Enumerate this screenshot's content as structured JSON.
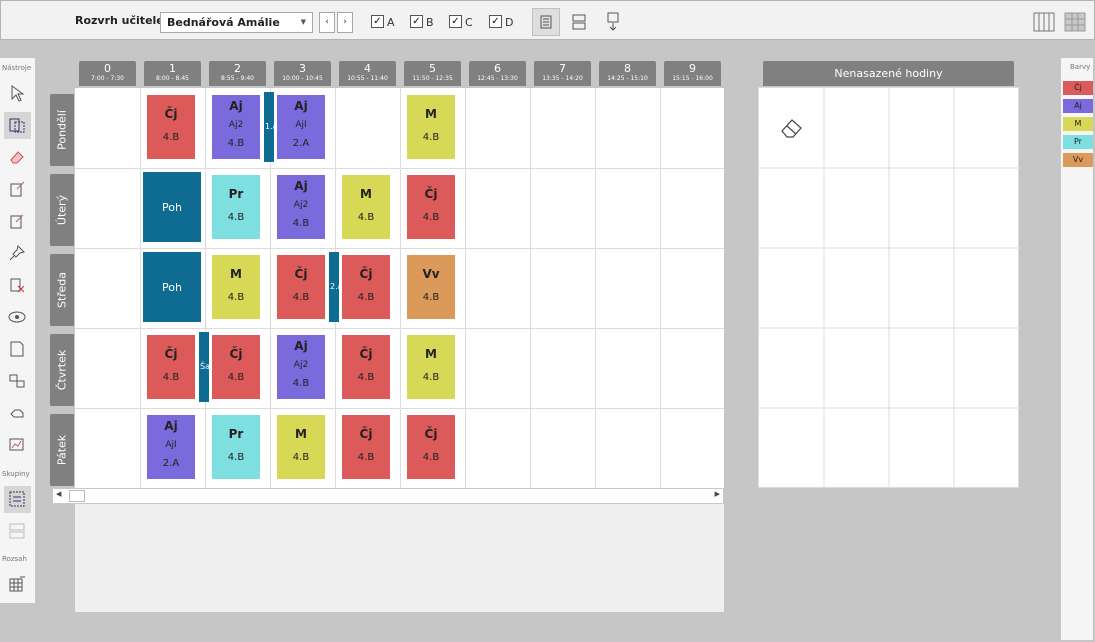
{
  "topbar": {
    "label": "Rozvrh učitele:",
    "teacher": "Bednářová Amálie",
    "prev": "‹",
    "next": "›",
    "checks": [
      {
        "label": "A",
        "checked": true
      },
      {
        "label": "B",
        "checked": true
      },
      {
        "label": "C",
        "checked": true
      },
      {
        "label": "D",
        "checked": true
      }
    ]
  },
  "toolbar": {
    "section_tools": "Nástroje",
    "section_groups": "Skupiny",
    "section_range": "Rozsah"
  },
  "periods": [
    {
      "n": "0",
      "time": "7:00 - 7:30"
    },
    {
      "n": "1",
      "time": "8:00 - 8:45"
    },
    {
      "n": "2",
      "time": "8:55 - 9:40"
    },
    {
      "n": "3",
      "time": "10:00 - 10:45"
    },
    {
      "n": "4",
      "time": "10:55 - 11:40"
    },
    {
      "n": "5",
      "time": "11:50 - 12:35"
    },
    {
      "n": "6",
      "time": "12:45 - 13:30"
    },
    {
      "n": "7",
      "time": "13:35 - 14:20"
    },
    {
      "n": "8",
      "time": "14:25 - 15:10"
    },
    {
      "n": "9",
      "time": "15:15 - 16:00"
    }
  ],
  "days": [
    "Pondělí",
    "Úterý",
    "Středa",
    "Čtvrtek",
    "Pátek"
  ],
  "colors": {
    "Čj": "#dc5a5a",
    "Aj": "#7a6adb",
    "M": "#d8d857",
    "Pr": "#7ddfe0",
    "Vv": "#db9a5a",
    "Poh": "#0e6b92"
  },
  "lessons": [
    {
      "day": 0,
      "period": 1,
      "subject": "Čj",
      "group": "",
      "cls": "4.B"
    },
    {
      "day": 0,
      "period": 2,
      "subject": "Aj",
      "group": "Aj2",
      "cls": "4.B"
    },
    {
      "day": 0,
      "period": 3,
      "subject": "Aj",
      "group": "AjI",
      "cls": "2.A"
    },
    {
      "day": 0,
      "period": 5,
      "subject": "M",
      "group": "",
      "cls": "4.B"
    },
    {
      "day": 1,
      "period": 1,
      "subject": "Poh",
      "group": "",
      "cls": "",
      "big": true
    },
    {
      "day": 1,
      "period": 2,
      "subject": "Pr",
      "group": "",
      "cls": "4.B"
    },
    {
      "day": 1,
      "period": 3,
      "subject": "Aj",
      "group": "Aj2",
      "cls": "4.B"
    },
    {
      "day": 1,
      "period": 4,
      "subject": "M",
      "group": "",
      "cls": "4.B"
    },
    {
      "day": 1,
      "period": 5,
      "subject": "Čj",
      "group": "",
      "cls": "4.B"
    },
    {
      "day": 2,
      "period": 1,
      "subject": "Poh",
      "group": "",
      "cls": "",
      "big": true
    },
    {
      "day": 2,
      "period": 2,
      "subject": "M",
      "group": "",
      "cls": "4.B"
    },
    {
      "day": 2,
      "period": 3,
      "subject": "Čj",
      "group": "",
      "cls": "4.B"
    },
    {
      "day": 2,
      "period": 4,
      "subject": "Čj",
      "group": "",
      "cls": "4.B"
    },
    {
      "day": 2,
      "period": 5,
      "subject": "Vv",
      "group": "",
      "cls": "4.B"
    },
    {
      "day": 3,
      "period": 1,
      "subject": "Čj",
      "group": "",
      "cls": "4.B"
    },
    {
      "day": 3,
      "period": 2,
      "subject": "Čj",
      "group": "",
      "cls": "4.B"
    },
    {
      "day": 3,
      "period": 3,
      "subject": "Aj",
      "group": "Aj2",
      "cls": "4.B"
    },
    {
      "day": 3,
      "period": 4,
      "subject": "Čj",
      "group": "",
      "cls": "4.B"
    },
    {
      "day": 3,
      "period": 5,
      "subject": "M",
      "group": "",
      "cls": "4.B"
    },
    {
      "day": 4,
      "period": 1,
      "subject": "Aj",
      "group": "AjI",
      "cls": "2.A"
    },
    {
      "day": 4,
      "period": 2,
      "subject": "Pr",
      "group": "",
      "cls": "4.B"
    },
    {
      "day": 4,
      "period": 3,
      "subject": "M",
      "group": "",
      "cls": "4.B"
    },
    {
      "day": 4,
      "period": 4,
      "subject": "Čj",
      "group": "",
      "cls": "4.B"
    },
    {
      "day": 4,
      "period": 5,
      "subject": "Čj",
      "group": "",
      "cls": "4.B"
    }
  ],
  "strips": [
    {
      "label": "1.a"
    },
    {
      "label": "2.a"
    },
    {
      "label": "Ša"
    }
  ],
  "unassigned": {
    "title": "Nenasazené hodiny"
  },
  "legend": {
    "title": "Barvy",
    "items": [
      "Čj",
      "Aj",
      "M",
      "Pr",
      "Vv"
    ]
  }
}
